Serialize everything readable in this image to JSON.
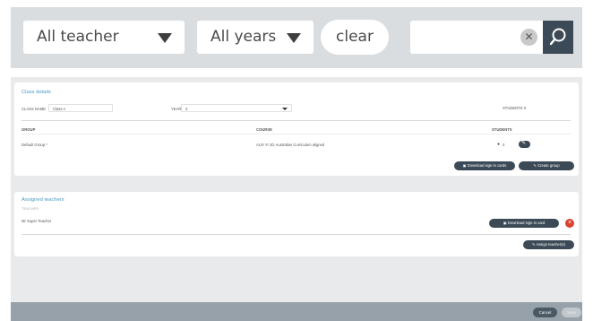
{
  "filters": {
    "teacher_value": "All teacher",
    "year_value": "All years",
    "clear_label": "clear",
    "search_value": "",
    "search_clear_glyph": "✕"
  },
  "class_details": {
    "title": "Class details",
    "class_name_label": "CLASS NAME",
    "class_name_value": "Class A",
    "year_label": "YEAR",
    "year_value": "3",
    "students_label": "STUDENTS",
    "students_count": "0",
    "columns": {
      "group": "GROUP",
      "course": "COURSE",
      "students": "STUDENTS"
    },
    "rows": [
      {
        "group": "Default Group *",
        "course": "AUS Yr 3G Australian Curriculum aligned",
        "students": "0"
      }
    ],
    "download_cards_label": "Download sign-in cards",
    "create_group_label": "Create group"
  },
  "assigned_teachers": {
    "title": "Assigned teachers",
    "subtitle": "TEACHER",
    "teachers": [
      {
        "name": "Mr Super Teacher",
        "download_label": "Download sign-in card"
      }
    ],
    "assign_label": "Assign teacher(s)"
  },
  "footer": {
    "cancel_label": "Cancel",
    "save_label": "Save"
  },
  "colors": {
    "accent_dark": "#3b4a56",
    "section_title": "#4a9bc5",
    "remove": "#d9432f"
  }
}
